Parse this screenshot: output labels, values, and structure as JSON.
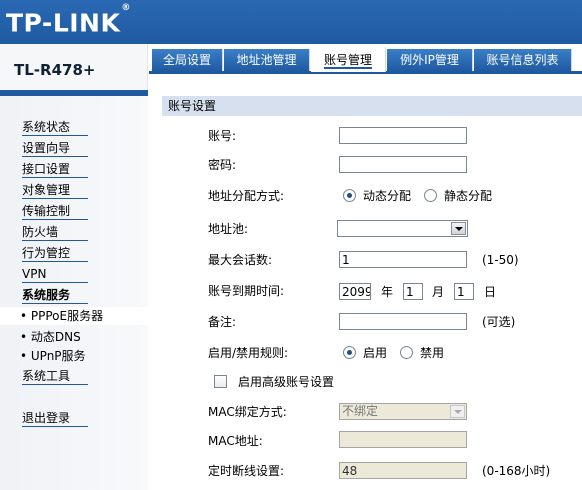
{
  "brand": {
    "logo": "TP-LINK",
    "logo_mark": "®",
    "model": "TL-R478+"
  },
  "tabs": [
    {
      "label": "全局设置",
      "active": false
    },
    {
      "label": "地址池管理",
      "active": false
    },
    {
      "label": "账号管理",
      "active": true
    },
    {
      "label": "例外IP管理",
      "active": false
    },
    {
      "label": "账号信息列表",
      "active": false
    }
  ],
  "sidebar": {
    "items": [
      {
        "label": "系统状态"
      },
      {
        "label": "设置向导"
      },
      {
        "label": "接口设置"
      },
      {
        "label": "对象管理"
      },
      {
        "label": "传输控制"
      },
      {
        "label": "防火墙"
      },
      {
        "label": "行为管控"
      },
      {
        "label": "VPN"
      },
      {
        "label": "系统服务"
      },
      {
        "label": "• PPPoE服务器"
      },
      {
        "label": "• 动态DNS"
      },
      {
        "label": "• UPnP服务"
      },
      {
        "label": "系统工具"
      },
      {
        "label": "退出登录"
      }
    ]
  },
  "form": {
    "section_title": "账号设置",
    "account_label": "账号:",
    "account_value": "",
    "password_label": "密码:",
    "password_value": "",
    "alloc_label": "地址分配方式:",
    "alloc_dynamic": "动态分配",
    "alloc_static": "静态分配",
    "pool_label": "地址池:",
    "pool_value": "",
    "max_sessions_label": "最大会话数:",
    "max_sessions_value": "1",
    "max_sessions_hint": "(1-50)",
    "expire_label": "账号到期时间:",
    "expire_year": "2099",
    "year_unit": "年",
    "expire_month": "1",
    "month_unit": "月",
    "expire_day": "1",
    "day_unit": "日",
    "note_label": "备注:",
    "note_value": "",
    "note_hint": "(可选)",
    "rule_label": "启用/禁用规则:",
    "rule_enable": "启用",
    "rule_disable": "禁用",
    "advanced_label": "启用高级账号设置",
    "mac_bind_label": "MAC绑定方式:",
    "mac_bind_value": "不绑定",
    "mac_addr_label": "MAC地址:",
    "mac_addr_value": "",
    "timeout_label": "定时断线设置:",
    "timeout_value": "48",
    "timeout_hint": "(0-168小时)"
  },
  "colors": {
    "brand_blue": "#1f5aa1",
    "section_bg": "#d6e0ee",
    "disabled_bg": "#ece9d8"
  }
}
